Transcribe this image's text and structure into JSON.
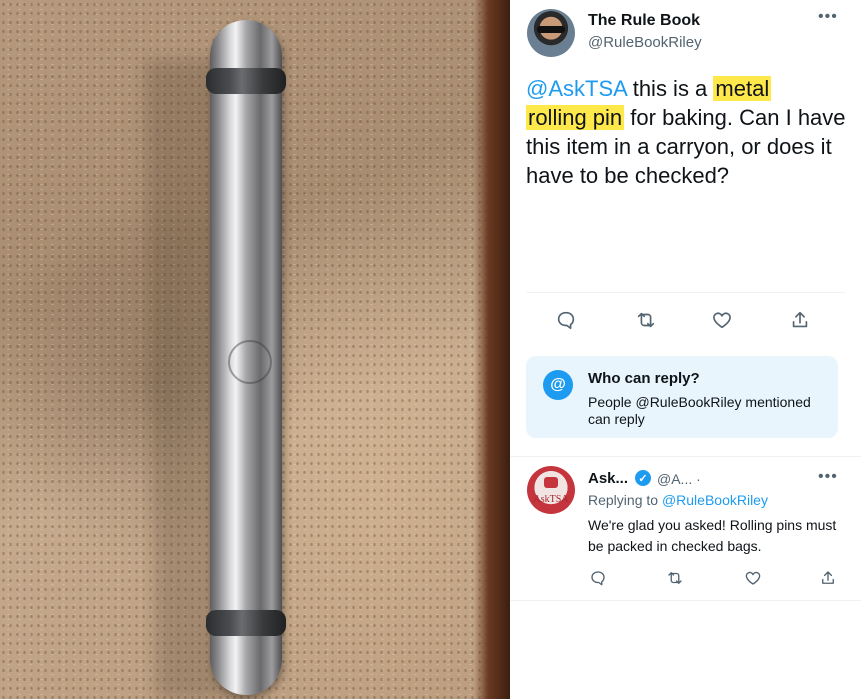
{
  "tweet": {
    "author_name": "The Rule Book",
    "author_handle": "@RuleBookRiley",
    "more_label": "•••",
    "mention": "@AskTSA",
    "text_1": " this is a ",
    "highlight_1": "metal",
    "highlight_2": "rolling pin",
    "text_2": " for baking. Can I have this item in a carryon, or does it have to be checked?",
    "actions": [
      "reply-icon",
      "retweet-icon",
      "like-icon",
      "share-icon"
    ]
  },
  "who_can_reply": {
    "icon": "@",
    "title": "Who can reply?",
    "body": "People @RuleBookRiley mentioned can reply"
  },
  "reply": {
    "author_name": "Ask...",
    "verified_mark": "✓",
    "author_handle": "@A... ·",
    "avatar_label": "AskTSA",
    "more_label": "•••",
    "replying_prefix": "Replying to ",
    "replying_to": "@RuleBookRiley",
    "text": "We're glad you asked! Rolling pins must be packed in checked bags.",
    "actions": [
      "reply-icon",
      "retweet-icon",
      "like-icon",
      "share-icon"
    ]
  },
  "colors": {
    "accent": "#1d9bf0",
    "highlight": "#ffe94a",
    "secondary_text": "#536471"
  }
}
